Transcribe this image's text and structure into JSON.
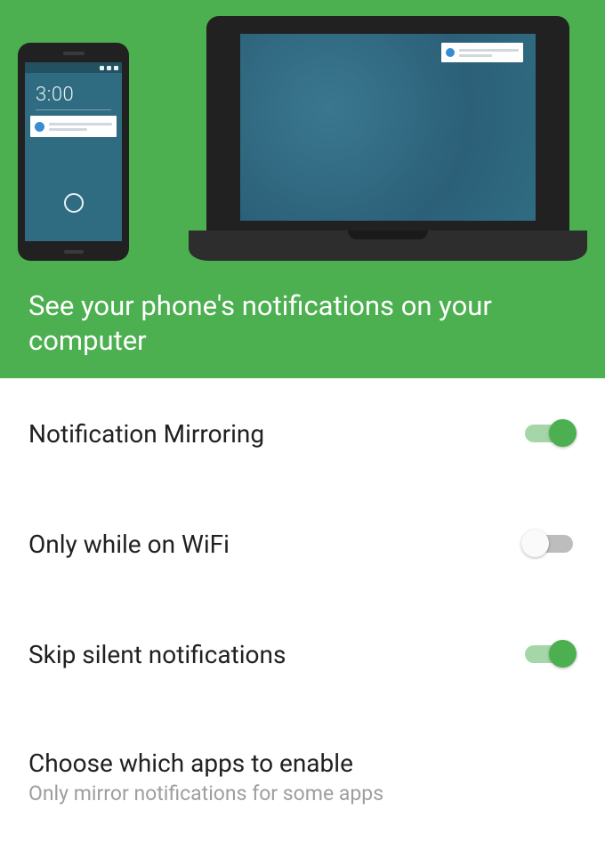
{
  "hero": {
    "phone_clock": "3:00",
    "headline": "See your phone's notifications on your computer"
  },
  "settings": [
    {
      "title": "Notification Mirroring",
      "enabled": true
    },
    {
      "title": "Only while on WiFi",
      "enabled": false
    },
    {
      "title": "Skip silent notifications",
      "enabled": true
    },
    {
      "title": "Choose which apps to enable",
      "subtitle": "Only mirror notifications for some apps"
    }
  ],
  "colors": {
    "accent": "#4caf50",
    "hero_bg": "#4caf50",
    "screen_bg": "#2f6c82"
  }
}
